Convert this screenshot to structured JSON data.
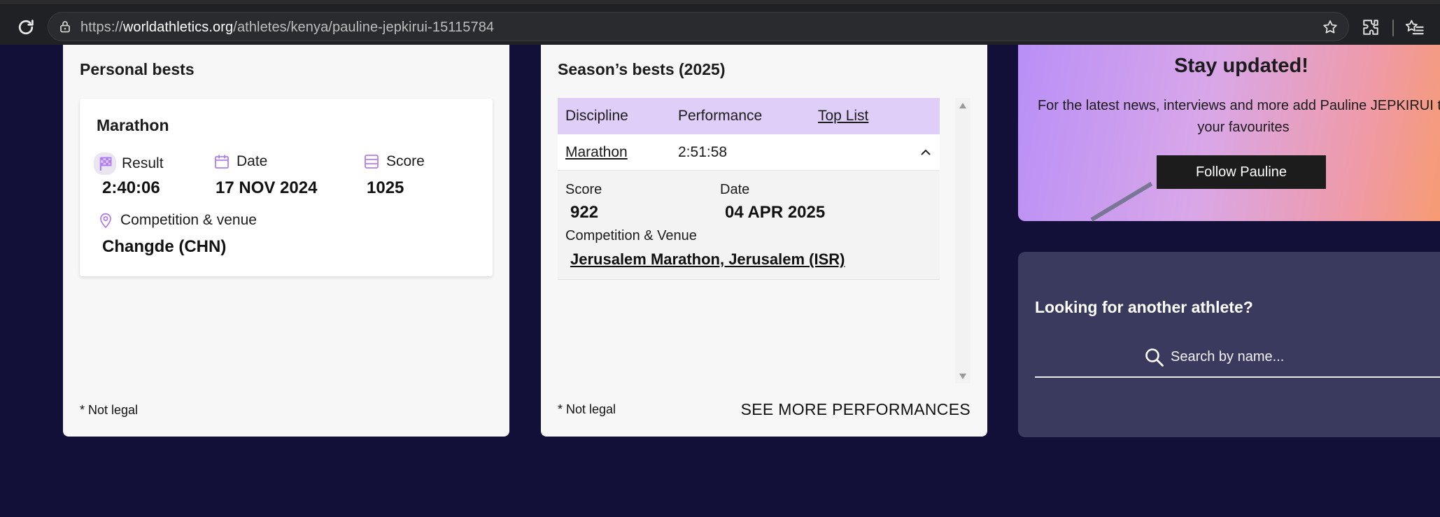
{
  "browser": {
    "url_protocol": "https://",
    "url_host": "worldathletics.org",
    "url_path": "/athletes/kenya/pauline-jepkirui-15115784"
  },
  "personal_bests": {
    "title": "Personal bests",
    "discipline": "Marathon",
    "result_label": "Result",
    "result_value": "2:40:06",
    "date_label": "Date",
    "date_value": "17 NOV 2024",
    "score_label": "Score",
    "score_value": "1025",
    "venue_label": "Competition & venue",
    "venue_value": "Changde (CHN)",
    "footnote": "* Not legal"
  },
  "season_bests": {
    "title": "Season’s bests (2025)",
    "columns": [
      "Discipline",
      "Performance",
      "Top List"
    ],
    "row": {
      "discipline": "Marathon",
      "performance": "2:51:58"
    },
    "detail": {
      "score_label": "Score",
      "score_value": "922",
      "date_label": "Date",
      "date_value": "04 APR 2025",
      "venue_label": "Competition & Venue",
      "venue_value": "Jerusalem Marathon, Jerusalem (ISR)"
    },
    "footnote": "* Not legal",
    "see_more": "SEE MORE PERFORMANCES"
  },
  "promo": {
    "title": "Stay updated!",
    "text_line1": "For the latest news, interviews and more add Pauline JEPKIRUI to",
    "text_line2": "your favourites",
    "button": "Follow Pauline"
  },
  "search": {
    "title": "Looking for another athlete?",
    "placeholder": "Search by name..."
  },
  "colors": {
    "page_bg": "#120f39",
    "table_header": "#dfcef8",
    "accent_purple": "#b07ef0"
  }
}
